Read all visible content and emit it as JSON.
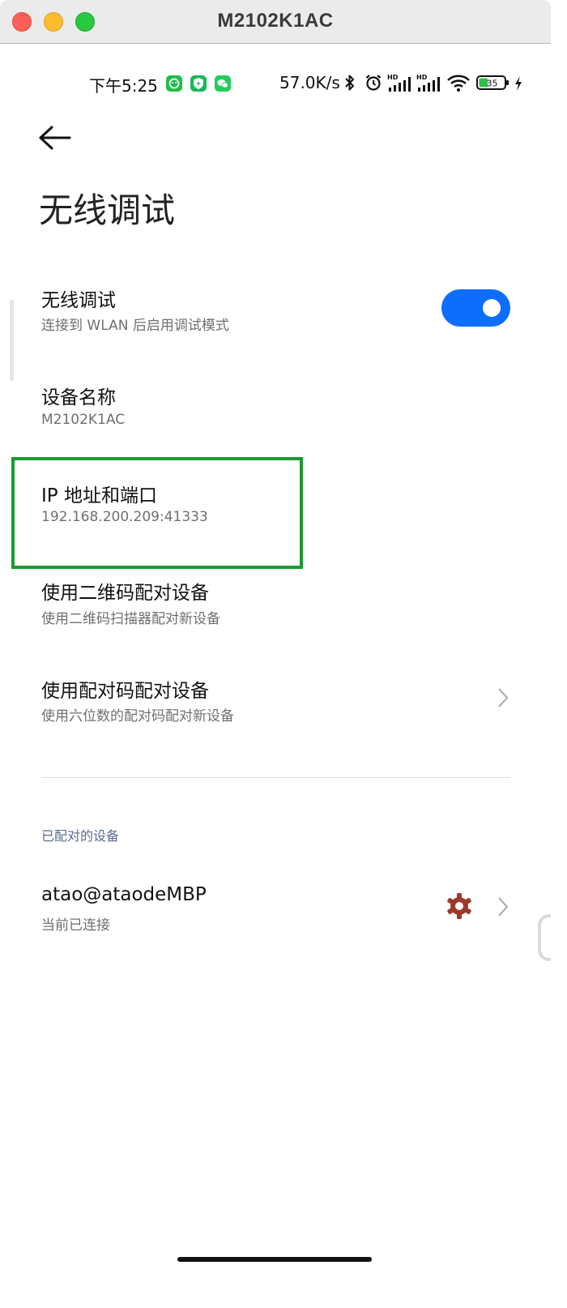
{
  "window": {
    "title": "M2102K1AC"
  },
  "status_bar": {
    "time": "下午5:25",
    "network_speed": "57.0K/s",
    "battery_level": "35",
    "icons": [
      "app-notify-icon",
      "shield-icon",
      "wechat-icon",
      "bluetooth-icon",
      "alarm-icon",
      "hd-signal-icon",
      "hd-signal-icon",
      "wifi-icon",
      "battery-icon",
      "charging-icon"
    ]
  },
  "page": {
    "title": "无线调试"
  },
  "settings": {
    "wireless_debugging": {
      "title": "无线调试",
      "subtitle": "连接到 WLAN 后启用调试模式",
      "enabled": true
    },
    "device_name": {
      "title": "设备名称",
      "value": "M2102K1AC"
    },
    "ip_address": {
      "title": "IP 地址和端口",
      "value": "192.168.200.209:41333"
    },
    "pair_qr": {
      "title": "使用二维码配对设备",
      "subtitle": "使用二维码扫描器配对新设备"
    },
    "pair_code": {
      "title": "使用配对码配对设备",
      "subtitle": "使用六位数的配对码配对新设备"
    }
  },
  "paired_devices": {
    "section_label": "已配对的设备",
    "items": [
      {
        "name": "atao@ataodeMBP",
        "status": "当前已连接"
      }
    ]
  },
  "colors": {
    "accent": "#0d6efd",
    "highlight": "#1a9a32",
    "gear": "#9c3a2a"
  }
}
